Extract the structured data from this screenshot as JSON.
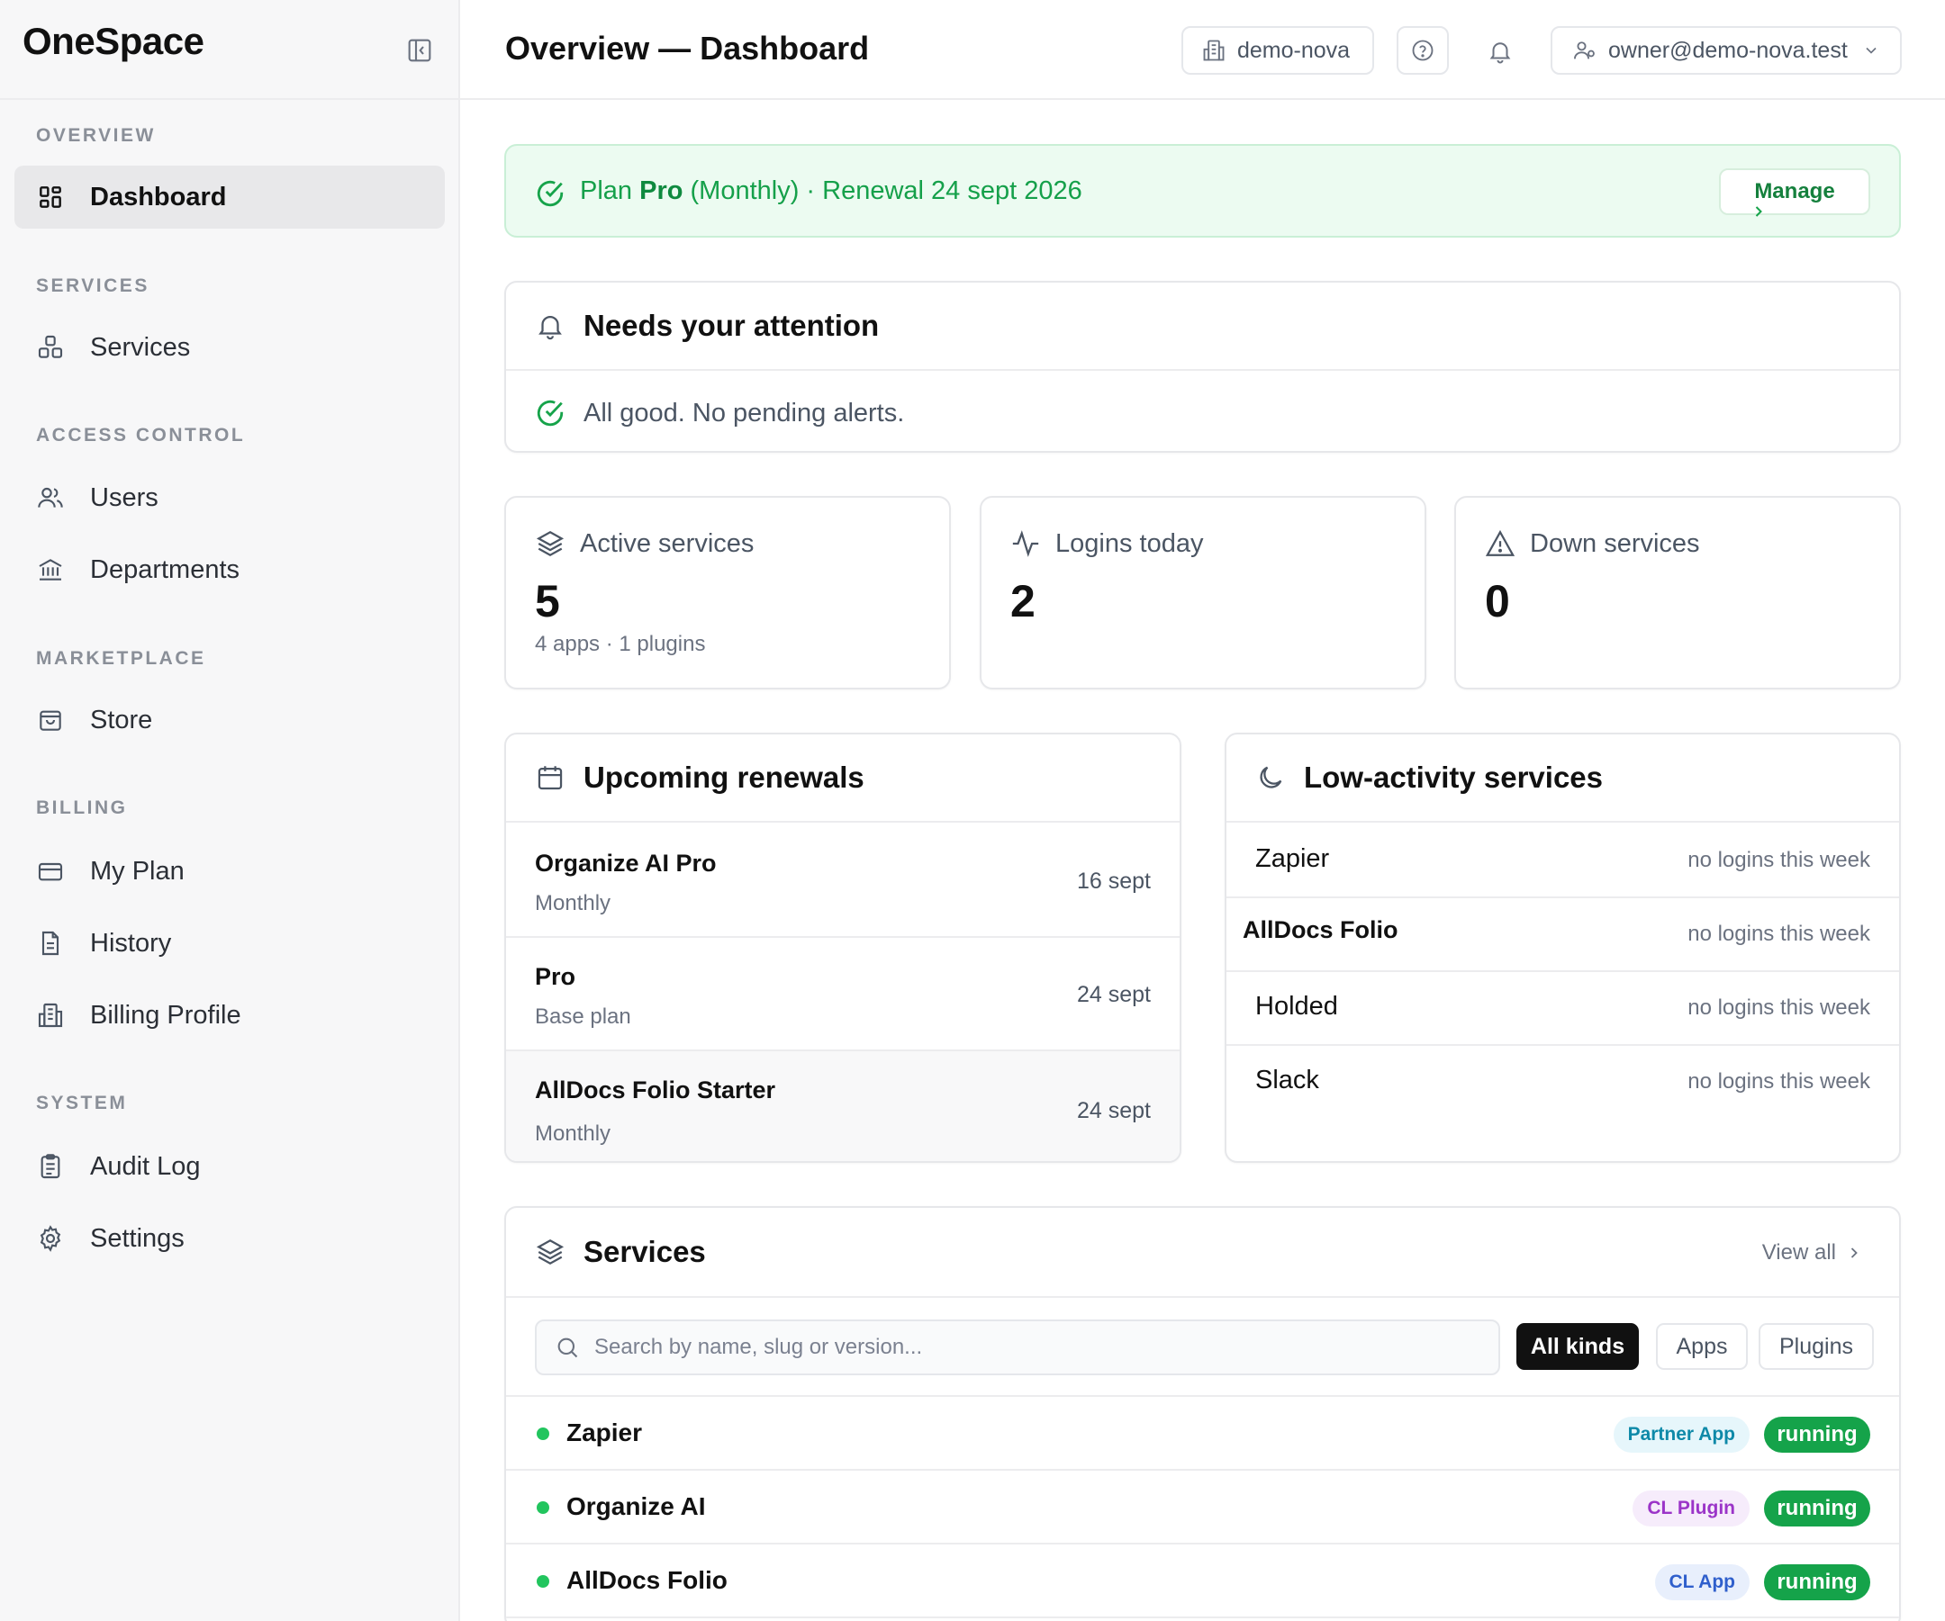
{
  "app": {
    "brand": "OneSpace"
  },
  "sidebar": {
    "sections": [
      {
        "title": "OVERVIEW"
      },
      {
        "title": "SERVICES"
      },
      {
        "title": "ACCESS CONTROL"
      },
      {
        "title": "MARKETPLACE"
      },
      {
        "title": "BILLING"
      },
      {
        "title": "SYSTEM"
      }
    ],
    "items": [
      {
        "label": "Dashboard",
        "icon": "dashboard-icon",
        "active": true
      },
      {
        "label": "Services",
        "icon": "services-icon"
      },
      {
        "label": "Users",
        "icon": "users-icon"
      },
      {
        "label": "Departments",
        "icon": "building-icon"
      },
      {
        "label": "Store",
        "icon": "store-icon"
      },
      {
        "label": "My Plan",
        "icon": "credit-card-icon"
      },
      {
        "label": "History",
        "icon": "document-icon"
      },
      {
        "label": "Billing Profile",
        "icon": "billing-profile-icon"
      },
      {
        "label": "Audit Log",
        "icon": "clipboard-icon"
      },
      {
        "label": "Settings",
        "icon": "gear-icon"
      }
    ]
  },
  "header": {
    "title": "Overview — Dashboard",
    "org": "demo-nova",
    "user": "owner@demo-nova.test"
  },
  "plan_banner": {
    "prefix": "Plan",
    "plan": "Pro",
    "suffix": "(Monthly) · Renewal 24 sept 2026",
    "manage": "Manage"
  },
  "attention": {
    "title": "Needs your attention",
    "message": "All good. No pending alerts."
  },
  "stats": [
    {
      "label": "Active services",
      "value": "5",
      "sub": "4 apps · 1 plugins",
      "icon": "layers-icon"
    },
    {
      "label": "Logins today",
      "value": "2",
      "sub": "",
      "icon": "activity-icon"
    },
    {
      "label": "Down services",
      "value": "0",
      "sub": "",
      "icon": "warning-icon"
    }
  ],
  "renewals": {
    "title": "Upcoming renewals",
    "rows": [
      {
        "name": "Organize AI Pro",
        "cycle": "Monthly",
        "date": "16 sept"
      },
      {
        "name": "Pro",
        "cycle": "Base plan",
        "date": "24 sept"
      },
      {
        "name": "AllDocs Folio Starter",
        "cycle": "Monthly",
        "date": "24 sept"
      }
    ]
  },
  "low_activity": {
    "title": "Low-activity services",
    "rows": [
      {
        "name": "Zapier",
        "note": "no logins this week"
      },
      {
        "name": "AllDocs Folio",
        "note": "no logins this week"
      },
      {
        "name": "Holded",
        "note": "no logins this week"
      },
      {
        "name": "Slack",
        "note": "no logins this week"
      }
    ]
  },
  "services": {
    "title": "Services",
    "view_all": "View all",
    "search_placeholder": "Search by name, slug or version...",
    "filters": [
      "All kinds",
      "Apps",
      "Plugins"
    ],
    "active_filter": "All kinds",
    "rows": [
      {
        "name": "Zapier",
        "kind": "Partner App",
        "status": "running"
      },
      {
        "name": "Organize AI",
        "kind": "CL Plugin",
        "status": "running"
      },
      {
        "name": "AllDocs Folio",
        "kind": "CL App",
        "status": "running"
      }
    ]
  },
  "colors": {
    "accent_green": "#16a34a",
    "banner_bg": "#ecfbf1",
    "status_dot": "#22c55e"
  }
}
